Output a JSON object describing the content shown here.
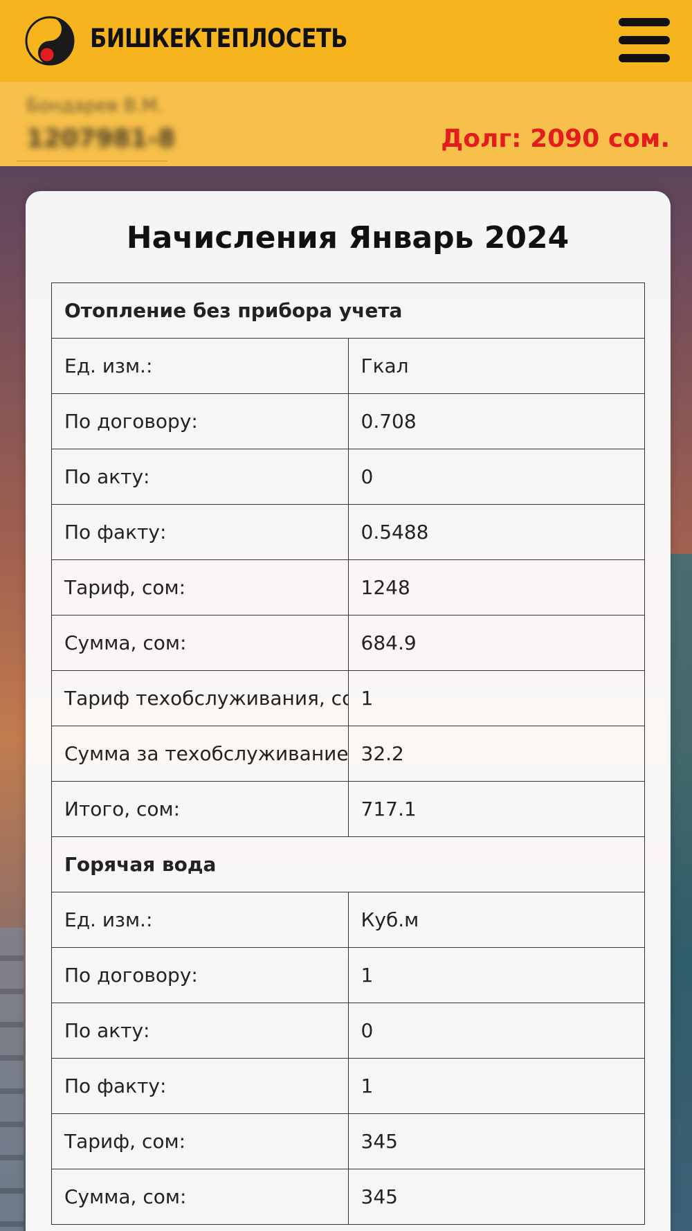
{
  "header": {
    "brand": "БИШКЕКТЕПЛОСЕТЬ",
    "colors": {
      "header_bg": "#f6b51f",
      "account_bg": "#f7c04a",
      "debt_text": "#e31d1d"
    },
    "icons": {
      "logo": "yin-yang-logo-icon",
      "menu": "hamburger-menu-icon"
    }
  },
  "account": {
    "name": "Бондарев В.М.",
    "number": "1207981-8",
    "debt_label": "Долг: 2090 сом."
  },
  "charges": {
    "title": "Начисления Январь 2024",
    "sections": [
      {
        "name": "Отопление без прибора учета",
        "rows": [
          {
            "label": "Ед. изм.:",
            "value": "Гкал"
          },
          {
            "label": "По договору:",
            "value": "0.708"
          },
          {
            "label": "По акту:",
            "value": "0"
          },
          {
            "label": "По факту:",
            "value": "0.5488"
          },
          {
            "label": "Тариф, сом:",
            "value": "1248"
          },
          {
            "label": "Сумма, сом:",
            "value": "684.9"
          },
          {
            "label": "Тариф техобслуживания, сом:",
            "value": "1"
          },
          {
            "label": "Сумма за техобслуживание, сом:",
            "value": "32.2"
          },
          {
            "label": "Итого, сом:",
            "value": "717.1"
          }
        ]
      },
      {
        "name": "Горячая вода",
        "rows": [
          {
            "label": "Ед. изм.:",
            "value": "Куб.м"
          },
          {
            "label": "По договору:",
            "value": "1"
          },
          {
            "label": "По акту:",
            "value": "0"
          },
          {
            "label": "По факту:",
            "value": "1"
          },
          {
            "label": "Тариф, сом:",
            "value": "345"
          },
          {
            "label": "Сумма, сом:",
            "value": "345"
          }
        ]
      }
    ]
  }
}
